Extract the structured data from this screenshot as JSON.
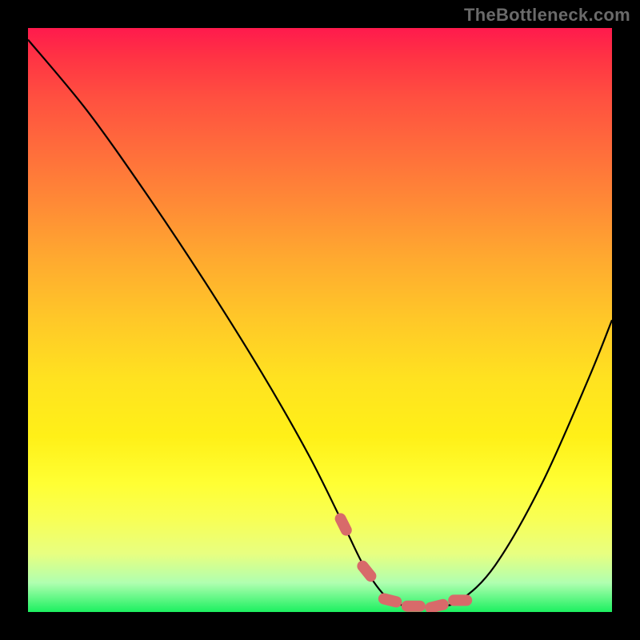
{
  "site_label": "TheBottleneck.com",
  "chart_data": {
    "type": "line",
    "title": "",
    "xlabel": "",
    "ylabel": "",
    "xlim": [
      0,
      100
    ],
    "ylim": [
      0,
      100
    ],
    "series": [
      {
        "name": "bottleneck-curve",
        "x": [
          0,
          10,
          20,
          30,
          40,
          48,
          54,
          58,
          62,
          66,
          70,
          74,
          80,
          88,
          96,
          100
        ],
        "values": [
          98,
          86,
          72,
          57,
          41,
          27,
          15,
          7,
          2,
          1,
          1,
          2,
          8,
          22,
          40,
          50
        ]
      }
    ],
    "markers": {
      "name": "optimal-range",
      "color": "#d86a6a",
      "x": [
        54,
        58,
        62,
        66,
        70,
        74
      ],
      "values": [
        15,
        7,
        2,
        1,
        1,
        2
      ]
    }
  }
}
